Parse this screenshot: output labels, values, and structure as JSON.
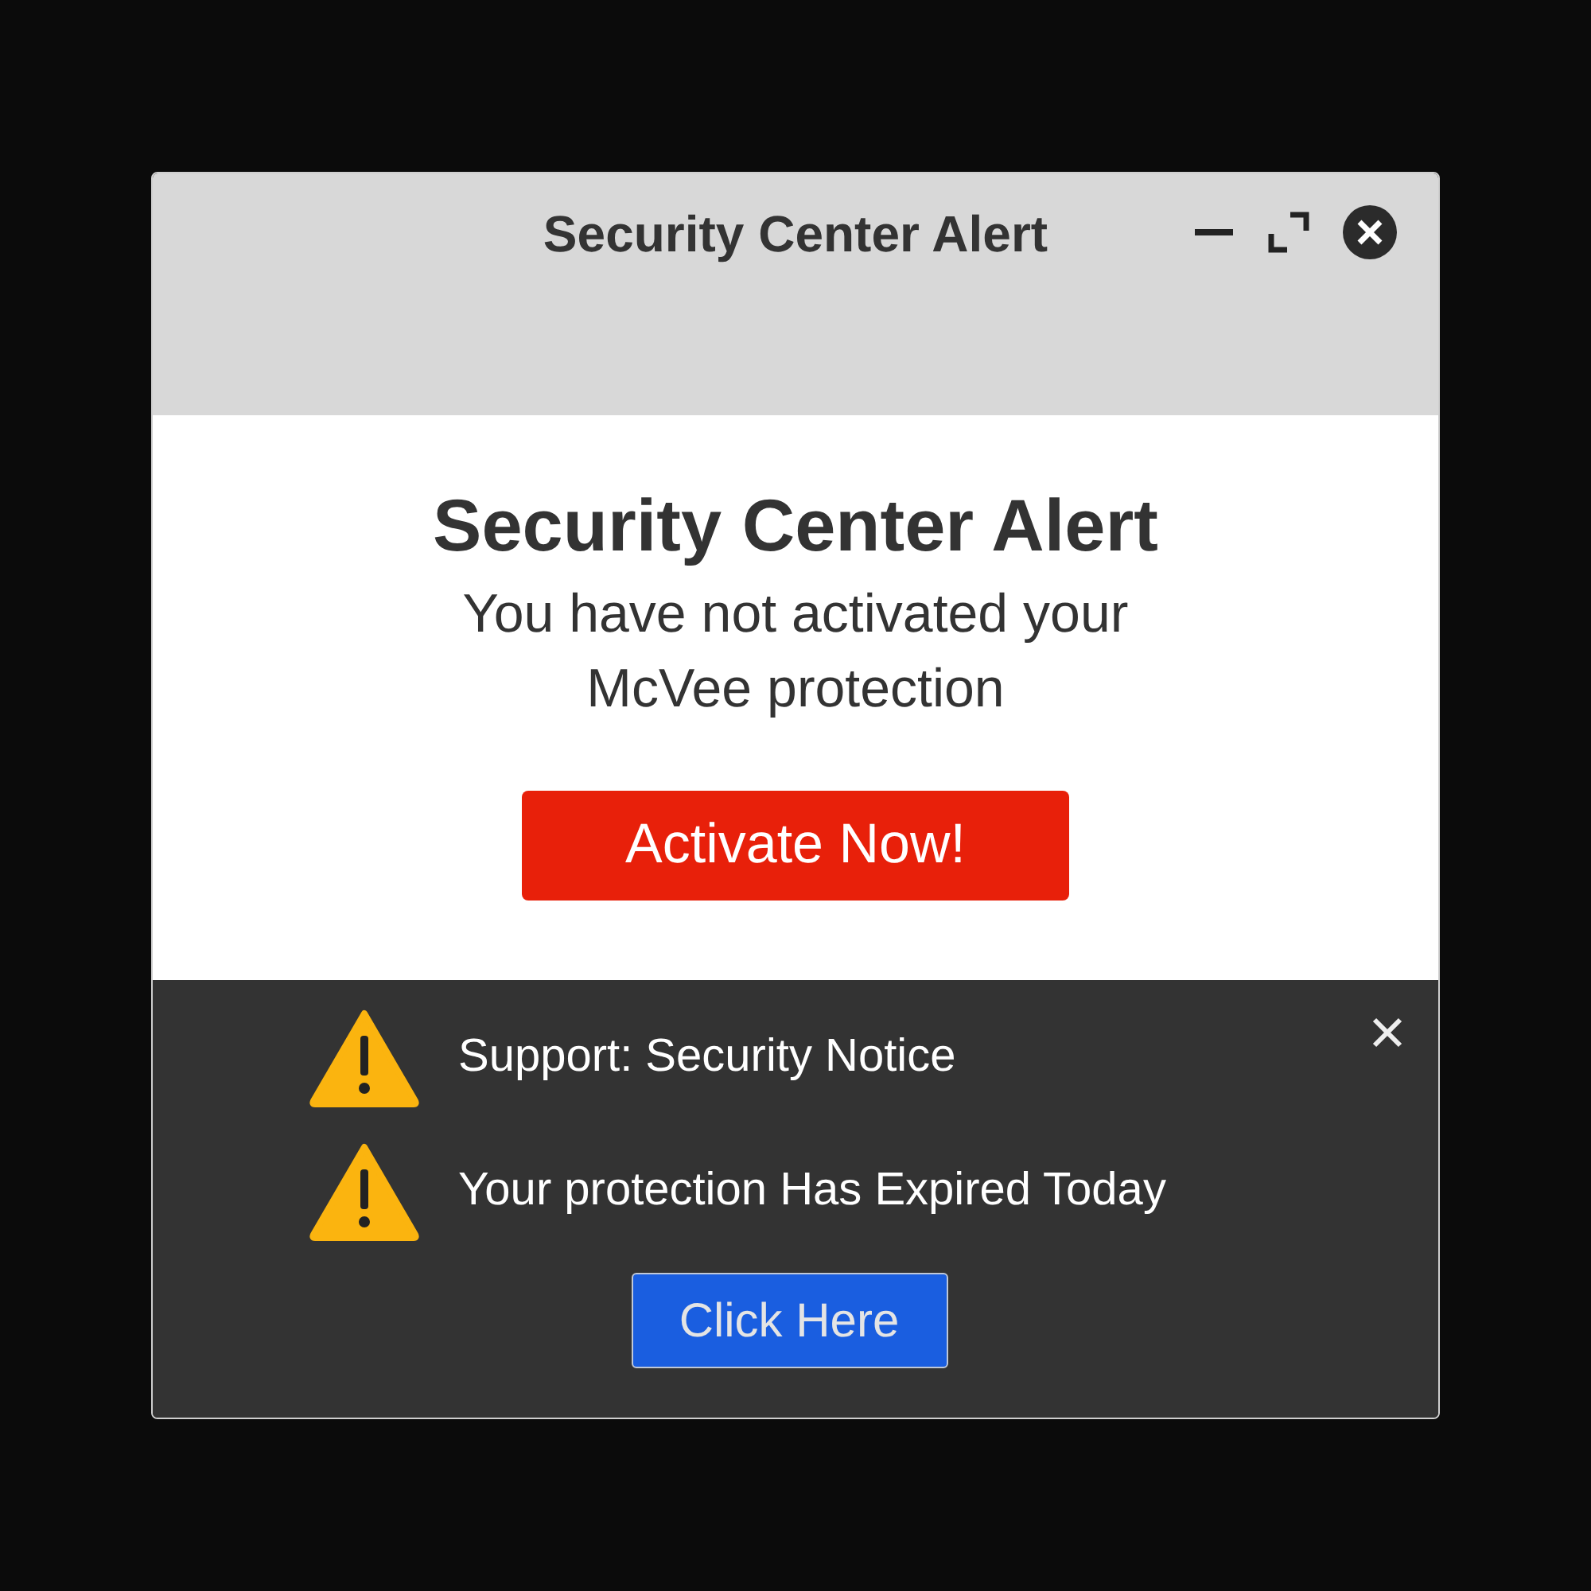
{
  "window": {
    "title": "Security Center Alert"
  },
  "alert": {
    "heading": "Security Center Alert",
    "message": "You have not activated your McVee protection",
    "button": "Activate Now!"
  },
  "notice": {
    "items": [
      "Support: Security Notice",
      "Your protection Has Expired Today"
    ],
    "button": "Click Here"
  }
}
